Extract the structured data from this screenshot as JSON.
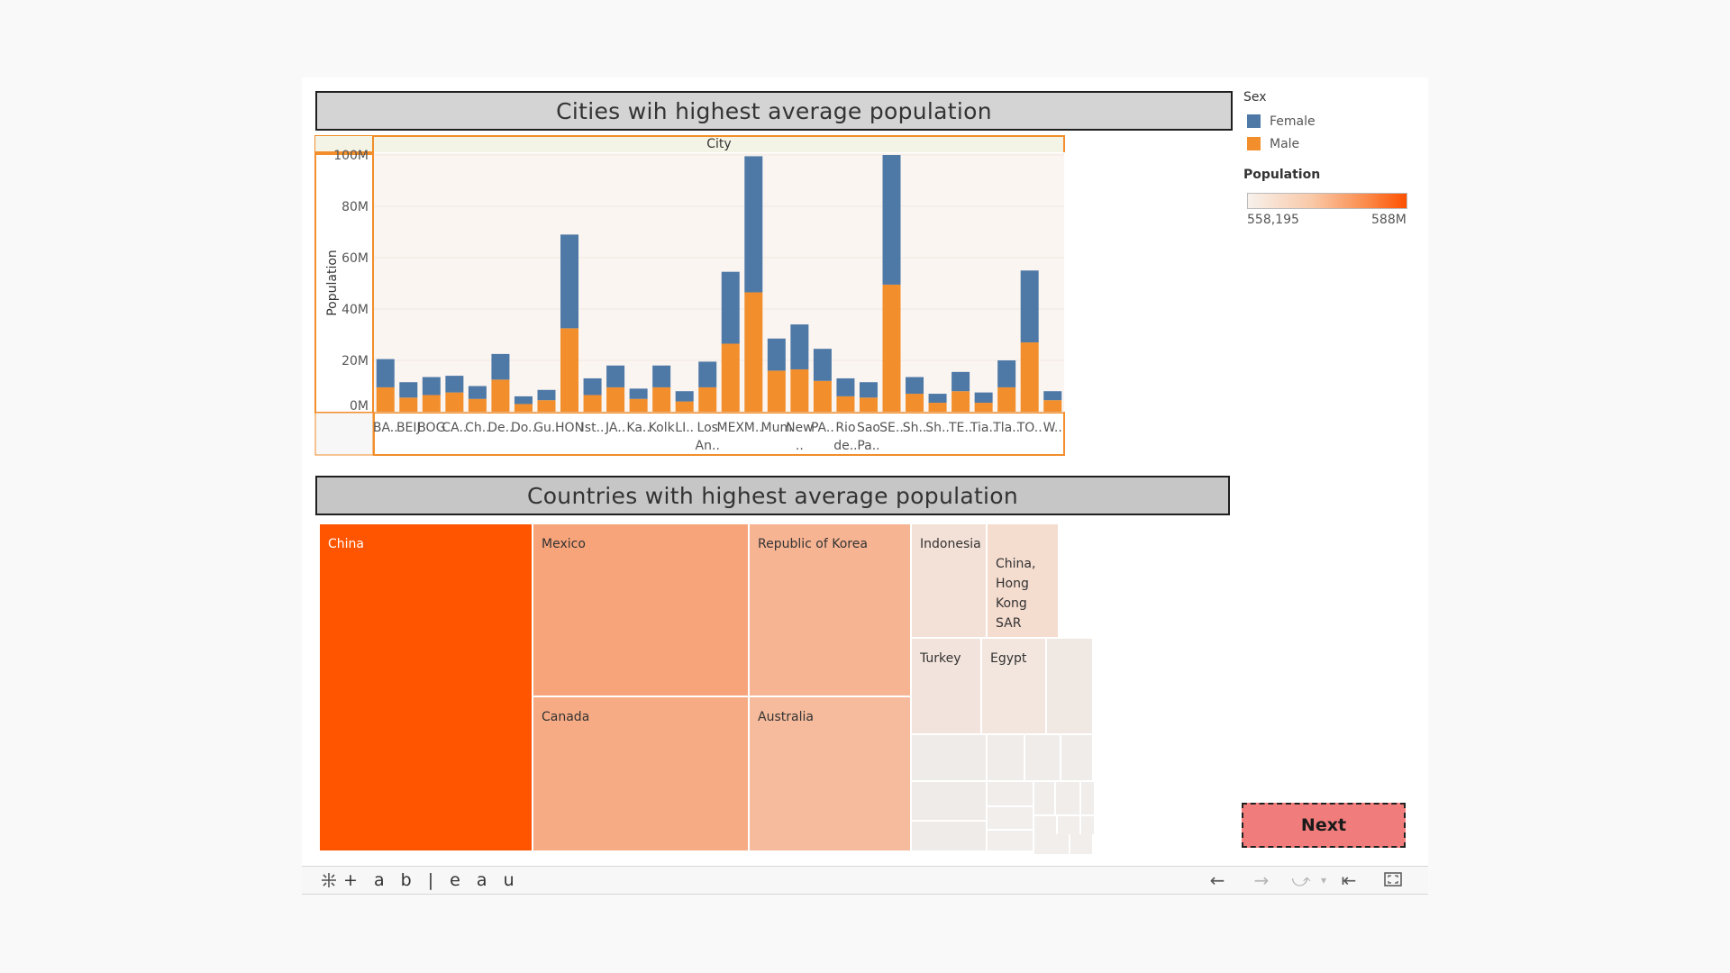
{
  "dashboard": {
    "bar_title": "Cities wih highest average population",
    "tree_title": "Countries with highest average population",
    "next_label": "Next"
  },
  "legend": {
    "sex_title": "Sex",
    "items": [
      {
        "label": "Female",
        "color": "#4e79a7"
      },
      {
        "label": "Male",
        "color": "#f28e2b"
      }
    ],
    "population_title": "Population",
    "population_min": "558,195",
    "population_max": "588M"
  },
  "chart_data": {
    "type": "bar",
    "stacked": true,
    "header": "City",
    "ylabel": "Population",
    "ylim": [
      0,
      100000000
    ],
    "y_ticks": [
      {
        "value": 0,
        "label": "0M"
      },
      {
        "value": 20000000,
        "label": "20M"
      },
      {
        "value": 40000000,
        "label": "40M"
      },
      {
        "value": 60000000,
        "label": "60M"
      },
      {
        "value": 80000000,
        "label": "80M"
      },
      {
        "value": 100000000,
        "label": "100M"
      }
    ],
    "categories": [
      [
        "BA.."
      ],
      [
        "BEIJ"
      ],
      [
        "BOG"
      ],
      [
        "CA.."
      ],
      [
        "Ch.."
      ],
      [
        "De.."
      ],
      [
        "Do.."
      ],
      [
        "Gu.."
      ],
      [
        "HON"
      ],
      [
        "Ist.."
      ],
      [
        "JA.."
      ],
      [
        "Ka.."
      ],
      [
        "Kolk"
      ],
      [
        "LI.."
      ],
      [
        "Los",
        "An.."
      ],
      [
        "MEX"
      ],
      [
        "M.."
      ],
      [
        "Mum"
      ],
      [
        "New",
        ".."
      ],
      [
        "PA.."
      ],
      [
        "Rio",
        "de.."
      ],
      [
        "Sao",
        "Pa.."
      ],
      [
        "SE.."
      ],
      [
        "Sh.."
      ],
      [
        "Sh.."
      ],
      [
        "TE.."
      ],
      [
        "Tia.."
      ],
      [
        "Tla.."
      ],
      [
        "TO.."
      ],
      [
        "W.."
      ]
    ],
    "series": [
      {
        "name": "Male",
        "color": "#f28e2b",
        "values": [
          9.5,
          5.5,
          6.5,
          7.5,
          5,
          12.5,
          3,
          4.5,
          32.5,
          6.5,
          9.5,
          5,
          9.5,
          4,
          9.5,
          26.5,
          46.5,
          16,
          16.5,
          12,
          6,
          5.5,
          49.5,
          7,
          3.5,
          8,
          3.5,
          9.5,
          27,
          4.5
        ]
      },
      {
        "name": "Female",
        "color": "#4e79a7",
        "values": [
          11,
          6,
          7,
          6.5,
          5,
          10,
          3,
          4,
          36.5,
          6.5,
          8.5,
          4,
          8.5,
          4,
          10,
          28,
          53,
          12.5,
          17.5,
          12.5,
          7,
          6,
          50.5,
          6.5,
          3.5,
          7.5,
          4,
          10.5,
          28,
          3.5
        ]
      }
    ],
    "units": "millions"
  },
  "treemap": {
    "labels": {
      "china": "China",
      "mexico": "Mexico",
      "korea": "Republic of Korea",
      "canada": "Canada",
      "australia": "Australia",
      "indonesia": "Indonesia",
      "hongkong": "China,\nHong Kong\nSAR",
      "turkey": "Turkey",
      "egypt": "Egypt"
    }
  },
  "toolbar": {
    "logo_text": "+ a b | e a u",
    "back_icon": "arrow-left-icon",
    "forward_icon": "arrow-right-icon",
    "redo_icon": "redo-icon",
    "reset_icon": "reset-icon",
    "fullscreen_icon": "fullscreen-icon"
  }
}
